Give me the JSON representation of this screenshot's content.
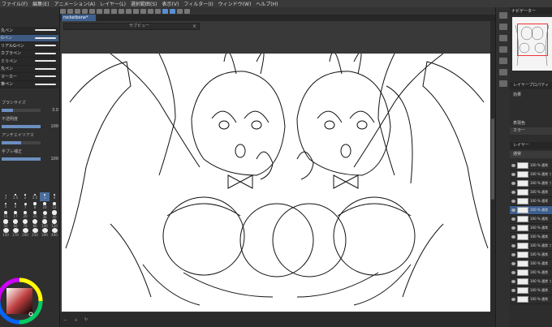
{
  "menu": [
    "ファイル(F)",
    "編集(E)",
    "アニメーション(A)",
    "レイヤー(L)",
    "選択範囲(S)",
    "表示(V)",
    "フィルター(I)",
    "ウィンドウ(W)",
    "ヘルプ(H)"
  ],
  "document_tab": "rocketbone*",
  "subview_title": "サブビュー",
  "left_panel": {
    "brushes": [
      {
        "name": "丸ペン",
        "selected": false
      },
      {
        "name": "Gペン",
        "selected": true
      },
      {
        "name": "リアルGペン",
        "selected": false
      },
      {
        "name": "カブラペン",
        "selected": false
      },
      {
        "name": "ミリペン",
        "selected": false
      },
      {
        "name": "丸ペン",
        "selected": false
      },
      {
        "name": "マーカー",
        "selected": false
      },
      {
        "name": "筆ペン",
        "selected": false
      }
    ],
    "properties": [
      {
        "label": "ブラシサイズ",
        "value": "3.0",
        "fill": 0.3
      },
      {
        "label": "不透明度",
        "value": "100",
        "fill": 1.0
      },
      {
        "label": "アンチエイリアス",
        "value": "",
        "fill": 0.5
      },
      {
        "label": "手ブレ補正",
        "value": "100",
        "fill": 1.0
      }
    ],
    "size_labels": [
      "1",
      "1.5",
      "2",
      "2.5",
      "3",
      "4",
      "5",
      "6",
      "7",
      "8",
      "10",
      "12",
      "15",
      "17",
      "20",
      "25",
      "30",
      "40",
      "50",
      "60",
      "70",
      "80",
      "100",
      "120",
      "150",
      "170",
      "200",
      "250",
      "300",
      "400"
    ],
    "selected_size": "3"
  },
  "right_panel": {
    "nav_tab": "ナビゲーター",
    "layer_property": "レイヤープロパティ",
    "effect_label": "効果",
    "expression_label": "表現色",
    "color_label": "カラー",
    "layer_tab": "レイヤー",
    "blend_mode": "通常",
    "layers": [
      {
        "name": "100 % 通常",
        "selected": false
      },
      {
        "name": "100 % 通常 フォルダー",
        "selected": false
      },
      {
        "name": "100 % 通常 フォルダー",
        "selected": false
      },
      {
        "name": "100 % 通常",
        "selected": false
      },
      {
        "name": "100 % 通常",
        "selected": false
      },
      {
        "name": "100 % 通常",
        "selected": true
      },
      {
        "name": "100 % 通常",
        "selected": false
      },
      {
        "name": "100 % 通常",
        "selected": false
      },
      {
        "name": "100 % 通常",
        "selected": false
      },
      {
        "name": "100 % 通常 フォルダー",
        "selected": false
      },
      {
        "name": "100 % 通常",
        "selected": false
      },
      {
        "name": "100 % 通常",
        "selected": false
      },
      {
        "name": "100 % 通常",
        "selected": false
      },
      {
        "name": "100 % 通常 フォルダー",
        "selected": false
      },
      {
        "name": "100 % 通常",
        "selected": false
      },
      {
        "name": "100 % 通常",
        "selected": false
      }
    ]
  },
  "colors": {
    "accent": "#3d5f8f",
    "main_color": "#000000",
    "sub_color": "#ffffff"
  }
}
